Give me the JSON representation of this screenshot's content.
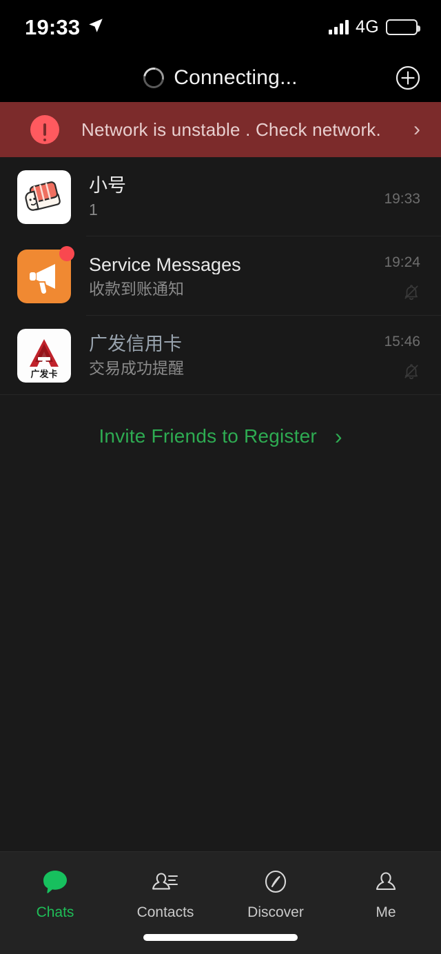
{
  "status_bar": {
    "time": "19:33",
    "location_icon": "location-arrow-icon",
    "signal_icon": "signal-bars-icon",
    "network_type": "4G",
    "battery_icon": "battery-icon"
  },
  "nav_bar": {
    "spinner_icon": "loading-spinner-icon",
    "title": "Connecting...",
    "add_icon": "plus-circle-icon"
  },
  "banner": {
    "alert_icon": "exclamation-circle-icon",
    "message": "Network is unstable . Check network.",
    "chevron": "›",
    "background_color": "#7c2b2b",
    "icon_color": "#ff5a5f"
  },
  "chats": [
    {
      "avatar_icon": "sushi-avatar",
      "title": "小号",
      "preview": "1",
      "time": "19:33",
      "muted": false,
      "unread_dot": false,
      "read_tint": false
    },
    {
      "avatar_icon": "megaphone-avatar",
      "title": "Service Messages",
      "preview": "收款到账通知",
      "time": "19:24",
      "muted": true,
      "mute_icon": "bell-muted-icon",
      "unread_dot": true,
      "read_tint": false
    },
    {
      "avatar_icon": "gf-card-avatar",
      "avatar_text": "广发卡",
      "title": "广发信用卡",
      "preview": "交易成功提醒",
      "time": "15:46",
      "muted": true,
      "mute_icon": "bell-muted-icon",
      "unread_dot": false,
      "read_tint": true
    }
  ],
  "invite": {
    "label": "Invite Friends to Register",
    "chevron": "›",
    "accent_color": "#2eab52"
  },
  "tab_bar": {
    "items": [
      {
        "label": "Chats",
        "icon": "chat-bubble-icon",
        "active": true
      },
      {
        "label": "Contacts",
        "icon": "contacts-icon",
        "active": false
      },
      {
        "label": "Discover",
        "icon": "compass-icon",
        "active": false
      },
      {
        "label": "Me",
        "icon": "person-icon",
        "active": false
      }
    ],
    "active_color": "#1fbe58"
  },
  "home_indicator": "home-indicator"
}
